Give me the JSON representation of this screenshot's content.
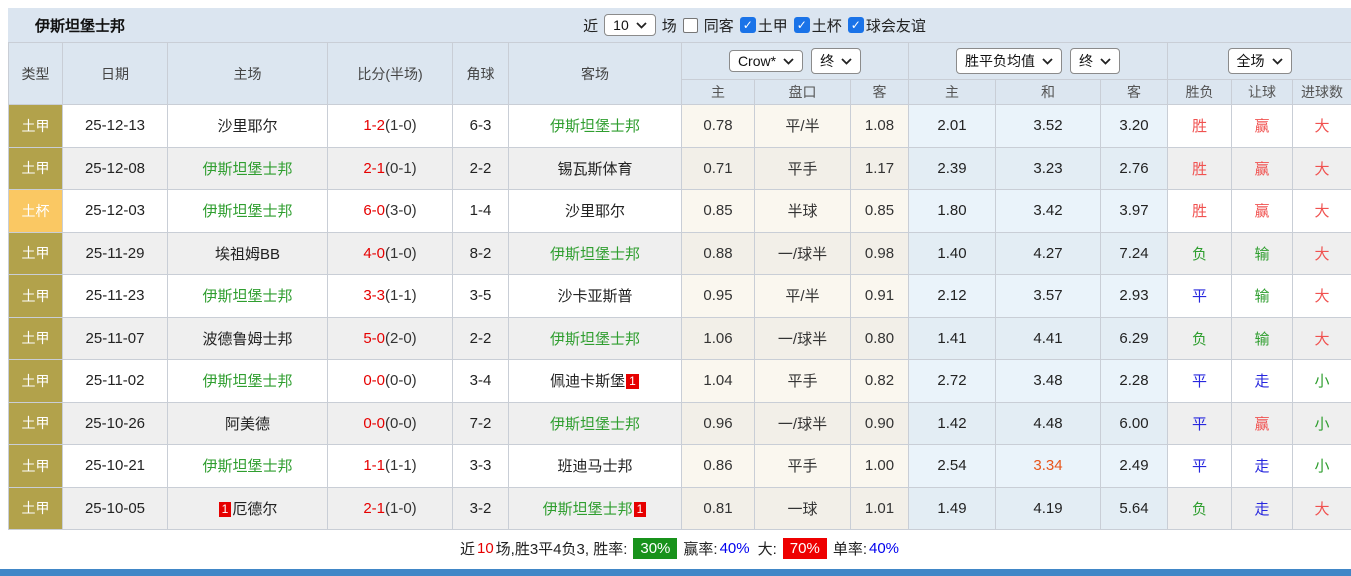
{
  "title": "伊斯坦堡士邦",
  "filter_bar": {
    "recent_label": "近",
    "recent_count": "10",
    "games_label": "场",
    "same_venue_label": "同客",
    "same_venue_checked": false,
    "leagues": [
      {
        "label": "土甲",
        "checked": true
      },
      {
        "label": "土杯",
        "checked": true
      },
      {
        "label": "球会友谊",
        "checked": true
      }
    ]
  },
  "table": {
    "columns": [
      "类型",
      "日期",
      "主场",
      "比分(半场)",
      "角球",
      "客场"
    ],
    "odds_company": "Crow*",
    "odds_time": "终",
    "avg_type": "胜平负均值",
    "avg_time": "终",
    "scope": "全场",
    "sub_headers": [
      "主",
      "盘口",
      "客",
      "主",
      "和",
      "客",
      "胜负",
      "让球",
      "进球数"
    ],
    "rows": [
      {
        "type": "土甲",
        "type_cls": "lg",
        "date": "25-12-13",
        "home": "沙里耶尔",
        "home_green": false,
        "home_badge_pre": "",
        "score": "1-2",
        "half": "(1-0)",
        "corners": "6-3",
        "away": "伊斯坦堡士邦",
        "away_green": true,
        "away_badge_post": "",
        "h_home": "0.78",
        "handicap": "平/半",
        "h_away": "1.08",
        "avg_home": "2.01",
        "avg_draw": "3.52",
        "avg_away": "3.20",
        "avg_draw_hot": false,
        "result": "胜",
        "result_c": "red",
        "let": "赢",
        "let_c": "red",
        "goals": "大",
        "goals_c": "red"
      },
      {
        "type": "土甲",
        "type_cls": "lg",
        "date": "25-12-08",
        "home": "伊斯坦堡士邦",
        "home_green": true,
        "home_badge_pre": "",
        "score": "2-1",
        "half": "(0-1)",
        "corners": "2-2",
        "away": "锡瓦斯体育",
        "away_green": false,
        "away_badge_post": "",
        "h_home": "0.71",
        "handicap": "平手",
        "h_away": "1.17",
        "avg_home": "2.39",
        "avg_draw": "3.23",
        "avg_away": "2.76",
        "avg_draw_hot": false,
        "result": "胜",
        "result_c": "red",
        "let": "赢",
        "let_c": "red",
        "goals": "大",
        "goals_c": "red"
      },
      {
        "type": "土杯",
        "type_cls": "cup",
        "date": "25-12-03",
        "home": "伊斯坦堡士邦",
        "home_green": true,
        "home_badge_pre": "",
        "score": "6-0",
        "half": "(3-0)",
        "corners": "1-4",
        "away": "沙里耶尔",
        "away_green": false,
        "away_badge_post": "",
        "h_home": "0.85",
        "handicap": "半球",
        "h_away": "0.85",
        "avg_home": "1.80",
        "avg_draw": "3.42",
        "avg_away": "3.97",
        "avg_draw_hot": false,
        "result": "胜",
        "result_c": "red",
        "let": "赢",
        "let_c": "red",
        "goals": "大",
        "goals_c": "red"
      },
      {
        "type": "土甲",
        "type_cls": "lg",
        "date": "25-11-29",
        "home": "埃祖姆BB",
        "home_green": false,
        "home_badge_pre": "",
        "score": "4-0",
        "half": "(1-0)",
        "corners": "8-2",
        "away": "伊斯坦堡士邦",
        "away_green": true,
        "away_badge_post": "",
        "h_home": "0.88",
        "handicap": "一/球半",
        "h_away": "0.98",
        "avg_home": "1.40",
        "avg_draw": "4.27",
        "avg_away": "7.24",
        "avg_draw_hot": false,
        "result": "负",
        "result_c": "green",
        "let": "输",
        "let_c": "green",
        "goals": "大",
        "goals_c": "red"
      },
      {
        "type": "土甲",
        "type_cls": "lg",
        "date": "25-11-23",
        "home": "伊斯坦堡士邦",
        "home_green": true,
        "home_badge_pre": "",
        "score": "3-3",
        "half": "(1-1)",
        "corners": "3-5",
        "away": "沙卡亚斯普",
        "away_green": false,
        "away_badge_post": "",
        "h_home": "0.95",
        "handicap": "平/半",
        "h_away": "0.91",
        "avg_home": "2.12",
        "avg_draw": "3.57",
        "avg_away": "2.93",
        "avg_draw_hot": false,
        "result": "平",
        "result_c": "blue",
        "let": "输",
        "let_c": "green",
        "goals": "大",
        "goals_c": "red"
      },
      {
        "type": "土甲",
        "type_cls": "lg",
        "date": "25-11-07",
        "home": "波德鲁姆士邦",
        "home_green": false,
        "home_badge_pre": "",
        "score": "5-0",
        "half": "(2-0)",
        "corners": "2-2",
        "away": "伊斯坦堡士邦",
        "away_green": true,
        "away_badge_post": "",
        "h_home": "1.06",
        "handicap": "一/球半",
        "h_away": "0.80",
        "avg_home": "1.41",
        "avg_draw": "4.41",
        "avg_away": "6.29",
        "avg_draw_hot": false,
        "result": "负",
        "result_c": "green",
        "let": "输",
        "let_c": "green",
        "goals": "大",
        "goals_c": "red"
      },
      {
        "type": "土甲",
        "type_cls": "lg",
        "date": "25-11-02",
        "home": "伊斯坦堡士邦",
        "home_green": true,
        "home_badge_pre": "",
        "score": "0-0",
        "half": "(0-0)",
        "corners": "3-4",
        "away": "佩迪卡斯堡",
        "away_green": false,
        "away_badge_post": "1",
        "h_home": "1.04",
        "handicap": "平手",
        "h_away": "0.82",
        "avg_home": "2.72",
        "avg_draw": "3.48",
        "avg_away": "2.28",
        "avg_draw_hot": false,
        "result": "平",
        "result_c": "blue",
        "let": "走",
        "let_c": "blue",
        "goals": "小",
        "goals_c": "green"
      },
      {
        "type": "土甲",
        "type_cls": "lg",
        "date": "25-10-26",
        "home": "阿美德",
        "home_green": false,
        "home_badge_pre": "",
        "score": "0-0",
        "half": "(0-0)",
        "corners": "7-2",
        "away": "伊斯坦堡士邦",
        "away_green": true,
        "away_badge_post": "",
        "h_home": "0.96",
        "handicap": "一/球半",
        "h_away": "0.90",
        "avg_home": "1.42",
        "avg_draw": "4.48",
        "avg_away": "6.00",
        "avg_draw_hot": false,
        "result": "平",
        "result_c": "blue",
        "let": "赢",
        "let_c": "red",
        "goals": "小",
        "goals_c": "green"
      },
      {
        "type": "土甲",
        "type_cls": "lg",
        "date": "25-10-21",
        "home": "伊斯坦堡士邦",
        "home_green": true,
        "home_badge_pre": "",
        "score": "1-1",
        "half": "(1-1)",
        "corners": "3-3",
        "away": "班迪马士邦",
        "away_green": false,
        "away_badge_post": "",
        "h_home": "0.86",
        "handicap": "平手",
        "h_away": "1.00",
        "avg_home": "2.54",
        "avg_draw": "3.34",
        "avg_away": "2.49",
        "avg_draw_hot": true,
        "result": "平",
        "result_c": "blue",
        "let": "走",
        "let_c": "blue",
        "goals": "小",
        "goals_c": "green"
      },
      {
        "type": "土甲",
        "type_cls": "lg",
        "date": "25-10-05",
        "home": "厄德尔",
        "home_green": false,
        "home_badge_pre": "1",
        "score": "2-1",
        "half": "(1-0)",
        "corners": "3-2",
        "away": "伊斯坦堡士邦",
        "away_green": true,
        "away_badge_post": "1",
        "h_home": "0.81",
        "handicap": "一球",
        "h_away": "1.01",
        "avg_home": "1.49",
        "avg_draw": "4.19",
        "avg_away": "5.64",
        "avg_draw_hot": false,
        "result": "负",
        "result_c": "green",
        "let": "走",
        "let_c": "blue",
        "goals": "大",
        "goals_c": "red"
      }
    ]
  },
  "footer": {
    "prefix": "近",
    "count": "10",
    "summary": "场,胜3平4负3, 胜率:",
    "win_rate": "30%",
    "handicap_label": "赢率:",
    "handicap_rate": "40%",
    "big_label": "大:",
    "big_rate": "70%",
    "single_label": "单率:",
    "single_rate": "40%"
  },
  "colors": {
    "header_bg": "#dce6f0",
    "league_badge": "#b2a24b",
    "cup_badge": "#fac863",
    "team_highlight_green": "#2f9e2f",
    "score_red": "#e60000",
    "result_red": "#f05250",
    "result_green": "#2f9e2f",
    "result_blue": "#2727de",
    "hot_odds_orange": "#e8551a",
    "win_rate_badge_green": "#18921b",
    "big_rate_badge_red": "#ee0000",
    "checkbox_blue": "#1a73e8",
    "bottom_bar_blue": "#4187c7"
  }
}
